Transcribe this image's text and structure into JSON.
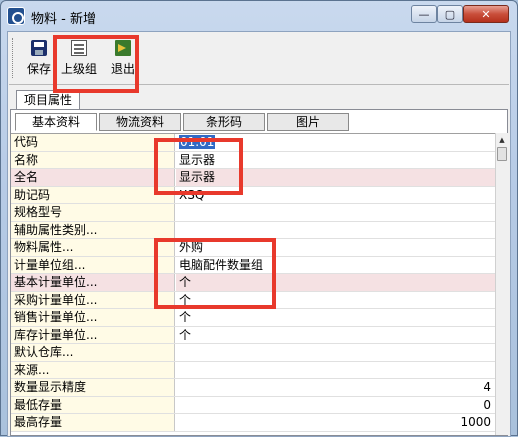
{
  "window": {
    "title": "物料 - 新增",
    "min_glyph": "—",
    "max_glyph": "▢",
    "close_glyph": "✕"
  },
  "toolbar": {
    "save_label": "保存",
    "parent_group_label": "上级组",
    "exit_label": "退出",
    "icons": {
      "save": "save-disk-icon",
      "parent_group": "document-list-icon",
      "exit": "exit-door-icon"
    }
  },
  "tabs": {
    "outer": "项目属性",
    "inner": [
      "基本资料",
      "物流资料",
      "条形码",
      "图片"
    ]
  },
  "grid": {
    "rows": [
      {
        "name": "代码",
        "value": "01.01"
      },
      {
        "name": "名称",
        "value": "显示器"
      },
      {
        "name": "全名",
        "value": "显示器"
      },
      {
        "name": "助记码",
        "value": "XSQ"
      },
      {
        "name": "规格型号",
        "value": ""
      },
      {
        "name": "辅助属性类别...",
        "value": ""
      },
      {
        "name": "物料属性...",
        "value": "外购"
      },
      {
        "name": "计量单位组...",
        "value": "电脑配件数量组"
      },
      {
        "name": "基本计量单位...",
        "value": "个"
      },
      {
        "name": "采购计量单位...",
        "value": "个"
      },
      {
        "name": "销售计量单位...",
        "value": "个"
      },
      {
        "name": "库存计量单位...",
        "value": "个"
      },
      {
        "name": "默认仓库...",
        "value": ""
      },
      {
        "name": "来源...",
        "value": ""
      },
      {
        "name": "数量显示精度",
        "value": "4"
      },
      {
        "name": "最低存量",
        "value": "0"
      },
      {
        "name": "最高存量",
        "value": "1000"
      }
    ]
  },
  "scrollbar": {
    "up_glyph": "▲"
  },
  "colors": {
    "highlight_box": "#e8392c",
    "name_cell_bg": "#fffbe6",
    "required_row_bg": "#f5e1e3",
    "selection": "#316ac5"
  }
}
